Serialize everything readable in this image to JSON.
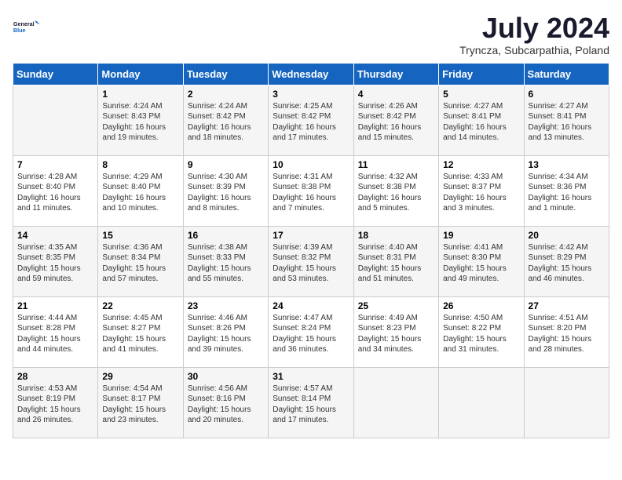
{
  "logo": {
    "line1": "General",
    "line2": "Blue"
  },
  "title": "July 2024",
  "subtitle": "Tryncza, Subcarpathia, Poland",
  "days_of_week": [
    "Sunday",
    "Monday",
    "Tuesday",
    "Wednesday",
    "Thursday",
    "Friday",
    "Saturday"
  ],
  "weeks": [
    [
      {
        "day": "",
        "info": ""
      },
      {
        "day": "1",
        "info": "Sunrise: 4:24 AM\nSunset: 8:43 PM\nDaylight: 16 hours\nand 19 minutes."
      },
      {
        "day": "2",
        "info": "Sunrise: 4:24 AM\nSunset: 8:42 PM\nDaylight: 16 hours\nand 18 minutes."
      },
      {
        "day": "3",
        "info": "Sunrise: 4:25 AM\nSunset: 8:42 PM\nDaylight: 16 hours\nand 17 minutes."
      },
      {
        "day": "4",
        "info": "Sunrise: 4:26 AM\nSunset: 8:42 PM\nDaylight: 16 hours\nand 15 minutes."
      },
      {
        "day": "5",
        "info": "Sunrise: 4:27 AM\nSunset: 8:41 PM\nDaylight: 16 hours\nand 14 minutes."
      },
      {
        "day": "6",
        "info": "Sunrise: 4:27 AM\nSunset: 8:41 PM\nDaylight: 16 hours\nand 13 minutes."
      }
    ],
    [
      {
        "day": "7",
        "info": "Sunrise: 4:28 AM\nSunset: 8:40 PM\nDaylight: 16 hours\nand 11 minutes."
      },
      {
        "day": "8",
        "info": "Sunrise: 4:29 AM\nSunset: 8:40 PM\nDaylight: 16 hours\nand 10 minutes."
      },
      {
        "day": "9",
        "info": "Sunrise: 4:30 AM\nSunset: 8:39 PM\nDaylight: 16 hours\nand 8 minutes."
      },
      {
        "day": "10",
        "info": "Sunrise: 4:31 AM\nSunset: 8:38 PM\nDaylight: 16 hours\nand 7 minutes."
      },
      {
        "day": "11",
        "info": "Sunrise: 4:32 AM\nSunset: 8:38 PM\nDaylight: 16 hours\nand 5 minutes."
      },
      {
        "day": "12",
        "info": "Sunrise: 4:33 AM\nSunset: 8:37 PM\nDaylight: 16 hours\nand 3 minutes."
      },
      {
        "day": "13",
        "info": "Sunrise: 4:34 AM\nSunset: 8:36 PM\nDaylight: 16 hours\nand 1 minute."
      }
    ],
    [
      {
        "day": "14",
        "info": "Sunrise: 4:35 AM\nSunset: 8:35 PM\nDaylight: 15 hours\nand 59 minutes."
      },
      {
        "day": "15",
        "info": "Sunrise: 4:36 AM\nSunset: 8:34 PM\nDaylight: 15 hours\nand 57 minutes."
      },
      {
        "day": "16",
        "info": "Sunrise: 4:38 AM\nSunset: 8:33 PM\nDaylight: 15 hours\nand 55 minutes."
      },
      {
        "day": "17",
        "info": "Sunrise: 4:39 AM\nSunset: 8:32 PM\nDaylight: 15 hours\nand 53 minutes."
      },
      {
        "day": "18",
        "info": "Sunrise: 4:40 AM\nSunset: 8:31 PM\nDaylight: 15 hours\nand 51 minutes."
      },
      {
        "day": "19",
        "info": "Sunrise: 4:41 AM\nSunset: 8:30 PM\nDaylight: 15 hours\nand 49 minutes."
      },
      {
        "day": "20",
        "info": "Sunrise: 4:42 AM\nSunset: 8:29 PM\nDaylight: 15 hours\nand 46 minutes."
      }
    ],
    [
      {
        "day": "21",
        "info": "Sunrise: 4:44 AM\nSunset: 8:28 PM\nDaylight: 15 hours\nand 44 minutes."
      },
      {
        "day": "22",
        "info": "Sunrise: 4:45 AM\nSunset: 8:27 PM\nDaylight: 15 hours\nand 41 minutes."
      },
      {
        "day": "23",
        "info": "Sunrise: 4:46 AM\nSunset: 8:26 PM\nDaylight: 15 hours\nand 39 minutes."
      },
      {
        "day": "24",
        "info": "Sunrise: 4:47 AM\nSunset: 8:24 PM\nDaylight: 15 hours\nand 36 minutes."
      },
      {
        "day": "25",
        "info": "Sunrise: 4:49 AM\nSunset: 8:23 PM\nDaylight: 15 hours\nand 34 minutes."
      },
      {
        "day": "26",
        "info": "Sunrise: 4:50 AM\nSunset: 8:22 PM\nDaylight: 15 hours\nand 31 minutes."
      },
      {
        "day": "27",
        "info": "Sunrise: 4:51 AM\nSunset: 8:20 PM\nDaylight: 15 hours\nand 28 minutes."
      }
    ],
    [
      {
        "day": "28",
        "info": "Sunrise: 4:53 AM\nSunset: 8:19 PM\nDaylight: 15 hours\nand 26 minutes."
      },
      {
        "day": "29",
        "info": "Sunrise: 4:54 AM\nSunset: 8:17 PM\nDaylight: 15 hours\nand 23 minutes."
      },
      {
        "day": "30",
        "info": "Sunrise: 4:56 AM\nSunset: 8:16 PM\nDaylight: 15 hours\nand 20 minutes."
      },
      {
        "day": "31",
        "info": "Sunrise: 4:57 AM\nSunset: 8:14 PM\nDaylight: 15 hours\nand 17 minutes."
      },
      {
        "day": "",
        "info": ""
      },
      {
        "day": "",
        "info": ""
      },
      {
        "day": "",
        "info": ""
      }
    ]
  ]
}
